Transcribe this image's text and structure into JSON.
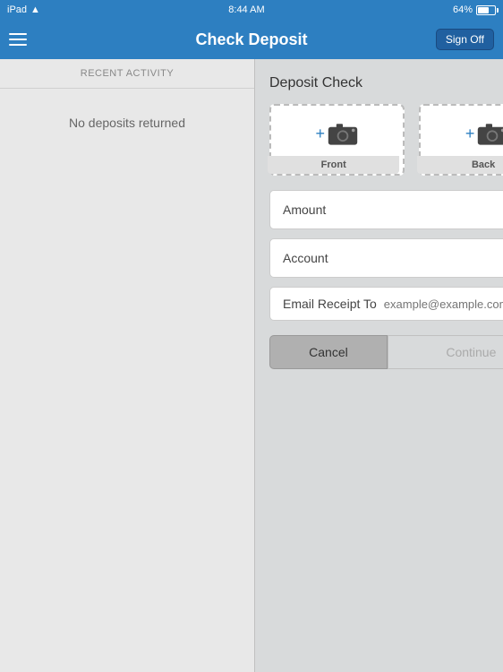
{
  "statusBar": {
    "device": "iPad",
    "wifi": "wifi",
    "time": "8:44 AM",
    "battery": "64%"
  },
  "header": {
    "title": "Check Deposit",
    "signOff": "Sign Off",
    "menuIcon": "≡"
  },
  "leftPanel": {
    "recentActivityLabel": "RECENT ACTIVITY",
    "emptyMessage": "No deposits returned"
  },
  "rightPanel": {
    "sectionTitle": "Deposit Check",
    "frontLabel": "Front",
    "backLabel": "Back",
    "amountLabel": "Amount",
    "accountLabel": "Account",
    "emailReceiptLabel": "Email Receipt To",
    "emailPlaceholder": "example@example.com",
    "cancelLabel": "Cancel",
    "continueLabel": "Continue"
  }
}
